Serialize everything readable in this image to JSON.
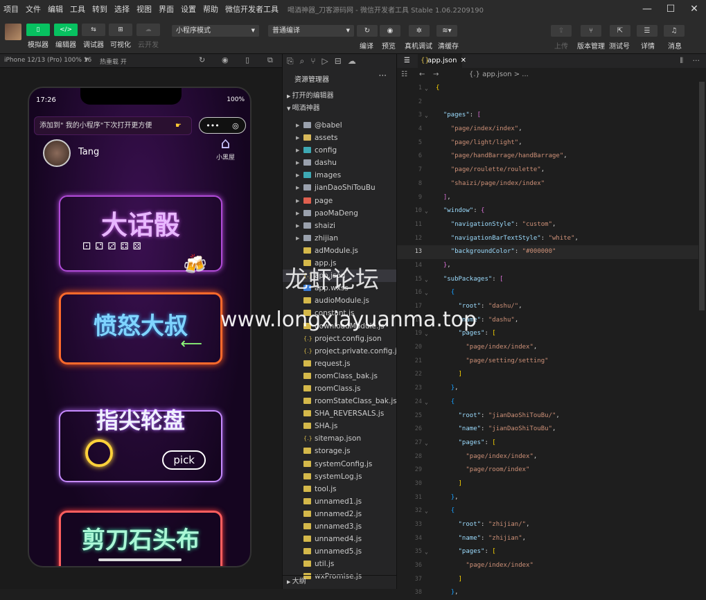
{
  "menu": [
    "项目",
    "文件",
    "编辑",
    "工具",
    "转到",
    "选择",
    "视图",
    "界面",
    "设置",
    "帮助",
    "微信开发者工具"
  ],
  "window_title": "喝酒神器_刀客源码网 - 微信开发者工具 Stable 1.06.2209190",
  "toolbar": {
    "left_buttons": [
      {
        "icon": "phone-icon",
        "label": "模拟器"
      },
      {
        "icon": "code-icon",
        "label": "编辑器"
      },
      {
        "icon": "debug-icon",
        "label": "调试器"
      },
      {
        "icon": "visual-icon",
        "label": "可视化"
      },
      {
        "icon": "cloud-icon",
        "label": "云开发"
      }
    ],
    "mode_select": "小程序模式",
    "compile_select": "普通编译",
    "mid_buttons": [
      "编译",
      "预览",
      "真机调试",
      "清缓存"
    ],
    "right_buttons": [
      "上传",
      "版本管理",
      "测试号",
      "详情",
      "消息"
    ]
  },
  "simulator": {
    "device": "iPhone 12/13 (Pro) 100% 16",
    "hotreload": "热重载 开",
    "status_time": "17:26",
    "battery": "100%",
    "tip": "添加到\" 我的小程序\"下次打开更方便",
    "capsule_more": "•••",
    "capsule_close": "◎",
    "username": "Tang",
    "home_label": "小黑屋",
    "cards": [
      {
        "title": "大话骰"
      },
      {
        "title": "愤怒大叔"
      },
      {
        "title": "指尖轮盘",
        "extra": "pick"
      },
      {
        "title": "剪刀石头布"
      }
    ]
  },
  "explorer": {
    "title": "资源管理器",
    "open_editors": "打开的编辑器",
    "project": "喝酒神器",
    "outline": "大纲",
    "items": [
      {
        "name": "@babel",
        "type": "folder"
      },
      {
        "name": "assets",
        "type": "yfolder"
      },
      {
        "name": "config",
        "type": "tfolder"
      },
      {
        "name": "dashu",
        "type": "folder"
      },
      {
        "name": "images",
        "type": "tfolder"
      },
      {
        "name": "jianDaoShiTouBu",
        "type": "folder"
      },
      {
        "name": "page",
        "type": "rfolder"
      },
      {
        "name": "paoMaDeng",
        "type": "folder"
      },
      {
        "name": "shaizi",
        "type": "folder"
      },
      {
        "name": "zhijian",
        "type": "folder"
      },
      {
        "name": "adModule.js",
        "type": "js"
      },
      {
        "name": "app.js",
        "type": "js"
      },
      {
        "name": "app.json",
        "type": "json"
      },
      {
        "name": "app.wxss",
        "type": "wxss"
      },
      {
        "name": "audioModule.js",
        "type": "js"
      },
      {
        "name": "constant.js",
        "type": "js"
      },
      {
        "name": "downloadModule.js",
        "type": "js"
      },
      {
        "name": "project.config.json",
        "type": "json"
      },
      {
        "name": "project.private.config.js...",
        "type": "json"
      },
      {
        "name": "request.js",
        "type": "js"
      },
      {
        "name": "roomClass_bak.js",
        "type": "js"
      },
      {
        "name": "roomClass.js",
        "type": "js"
      },
      {
        "name": "roomStateClass_bak.js",
        "type": "js"
      },
      {
        "name": "SHA_REVERSALS.js",
        "type": "js"
      },
      {
        "name": "SHA.js",
        "type": "js"
      },
      {
        "name": "sitemap.json",
        "type": "json"
      },
      {
        "name": "storage.js",
        "type": "js"
      },
      {
        "name": "systemConfig.js",
        "type": "js"
      },
      {
        "name": "systemLog.js",
        "type": "js"
      },
      {
        "name": "tool.js",
        "type": "js"
      },
      {
        "name": "unnamed1.js",
        "type": "js"
      },
      {
        "name": "unnamed2.js",
        "type": "js"
      },
      {
        "name": "unnamed3.js",
        "type": "js"
      },
      {
        "name": "unnamed4.js",
        "type": "js"
      },
      {
        "name": "unnamed5.js",
        "type": "js"
      },
      {
        "name": "util.js",
        "type": "js"
      },
      {
        "name": "wxPromise.js",
        "type": "js"
      }
    ]
  },
  "editor": {
    "tab_label": "app.json",
    "breadcrumb": "{.} app.json > ...",
    "current_line": 13,
    "lines": [
      {
        "n": 1,
        "html": "<span class='brk'>{</span>",
        "fold": true
      },
      {
        "n": 2,
        "html": ""
      },
      {
        "n": 3,
        "html": "  <span class='key'>\"pages\"</span><span class='pun'>: </span><span class='brk2'>[</span>",
        "fold": true
      },
      {
        "n": 4,
        "html": "    <span class='str'>\"page/index/index\"</span><span class='pun'>,</span>"
      },
      {
        "n": 5,
        "html": "    <span class='str'>\"page/light/light\"</span><span class='pun'>,</span>"
      },
      {
        "n": 6,
        "html": "    <span class='str'>\"page/handBarrage/handBarrage\"</span><span class='pun'>,</span>"
      },
      {
        "n": 7,
        "html": "    <span class='str'>\"page/roulette/roulette\"</span><span class='pun'>,</span>"
      },
      {
        "n": 8,
        "html": "    <span class='str'>\"shaizi/page/index/index\"</span>"
      },
      {
        "n": 9,
        "html": "  <span class='brk2'>]</span><span class='pun'>,</span>"
      },
      {
        "n": 10,
        "html": "  <span class='key'>\"window\"</span><span class='pun'>: </span><span class='brk2'>{</span>",
        "fold": true
      },
      {
        "n": 11,
        "html": "    <span class='key'>\"navigationStyle\"</span><span class='pun'>: </span><span class='str'>\"custom\"</span><span class='pun'>,</span>"
      },
      {
        "n": 12,
        "html": "    <span class='key'>\"navigationBarTextStyle\"</span><span class='pun'>: </span><span class='str'>\"white\"</span><span class='pun'>,</span>"
      },
      {
        "n": 13,
        "html": "    <span class='key'>\"backgroundColor\"</span><span class='pun'>: </span><span class='str'>\"#000000\"</span>"
      },
      {
        "n": 14,
        "html": "  <span class='brk2'>}</span><span class='pun'>,</span>"
      },
      {
        "n": 15,
        "html": "  <span class='key'>\"subPackages\"</span><span class='pun'>: </span><span class='brk2'>[</span>",
        "fold": true
      },
      {
        "n": 16,
        "html": "    <span class='brk3'>{</span>",
        "fold": true
      },
      {
        "n": 17,
        "html": "      <span class='key'>\"root\"</span><span class='pun'>: </span><span class='str'>\"dashu/\"</span><span class='pun'>,</span>"
      },
      {
        "n": 18,
        "html": "      <span class='key'>\"name\"</span><span class='pun'>: </span><span class='str'>\"dashu\"</span><span class='pun'>,</span>"
      },
      {
        "n": 19,
        "html": "      <span class='key'>\"pages\"</span><span class='pun'>: </span><span class='brk'>[</span>",
        "fold": true
      },
      {
        "n": 20,
        "html": "        <span class='str'>\"page/index/index\"</span><span class='pun'>,</span>"
      },
      {
        "n": 21,
        "html": "        <span class='str'>\"page/setting/setting\"</span>"
      },
      {
        "n": 22,
        "html": "      <span class='brk'>]</span>"
      },
      {
        "n": 23,
        "html": "    <span class='brk3'>}</span><span class='pun'>,</span>"
      },
      {
        "n": 24,
        "html": "    <span class='brk3'>{</span>",
        "fold": true
      },
      {
        "n": 25,
        "html": "      <span class='key'>\"root\"</span><span class='pun'>: </span><span class='str'>\"jianDaoShiTouBu/\"</span><span class='pun'>,</span>"
      },
      {
        "n": 26,
        "html": "      <span class='key'>\"name\"</span><span class='pun'>: </span><span class='str'>\"jianDaoShiTouBu\"</span><span class='pun'>,</span>"
      },
      {
        "n": 27,
        "html": "      <span class='key'>\"pages\"</span><span class='pun'>: </span><span class='brk'>[</span>",
        "fold": true
      },
      {
        "n": 28,
        "html": "        <span class='str'>\"page/index/index\"</span><span class='pun'>,</span>"
      },
      {
        "n": 29,
        "html": "        <span class='str'>\"page/room/index\"</span>"
      },
      {
        "n": 30,
        "html": "      <span class='brk'>]</span>"
      },
      {
        "n": 31,
        "html": "    <span class='brk3'>}</span><span class='pun'>,</span>"
      },
      {
        "n": 32,
        "html": "    <span class='brk3'>{</span>",
        "fold": true
      },
      {
        "n": 33,
        "html": "      <span class='key'>\"root\"</span><span class='pun'>: </span><span class='str'>\"zhijian/\"</span><span class='pun'>,</span>"
      },
      {
        "n": 34,
        "html": "      <span class='key'>\"name\"</span><span class='pun'>: </span><span class='str'>\"zhijian\"</span><span class='pun'>,</span>"
      },
      {
        "n": 35,
        "html": "      <span class='key'>\"pages\"</span><span class='pun'>: </span><span class='brk'>[</span>",
        "fold": true
      },
      {
        "n": 36,
        "html": "        <span class='str'>\"page/index/index\"</span>"
      },
      {
        "n": 37,
        "html": "      <span class='brk'>]</span>"
      },
      {
        "n": 38,
        "html": "    <span class='brk3'>}</span><span class='pun'>,</span>"
      }
    ]
  },
  "watermark": {
    "line1": "龙虾论坛",
    "line2": "www.longxiayuanma.top"
  }
}
